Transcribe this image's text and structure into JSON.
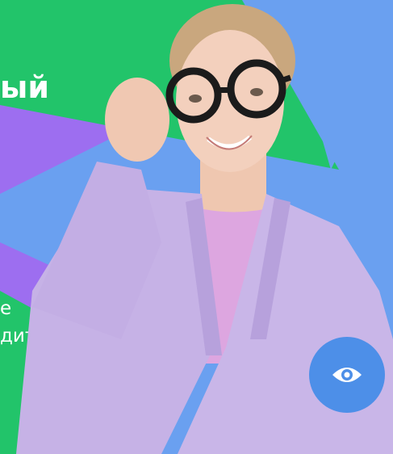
{
  "hero": {
    "headline_fragment": "ый",
    "subtext_line1": "е",
    "subtext_line2": "дитель."
  },
  "accessibility_button": {
    "icon": "eye-icon"
  },
  "colors": {
    "blue": "#6aa0f0",
    "purple": "#9d6ef0",
    "green": "#22c46a",
    "jacket": "#c6b2e6",
    "button": "#4d8fe8"
  }
}
